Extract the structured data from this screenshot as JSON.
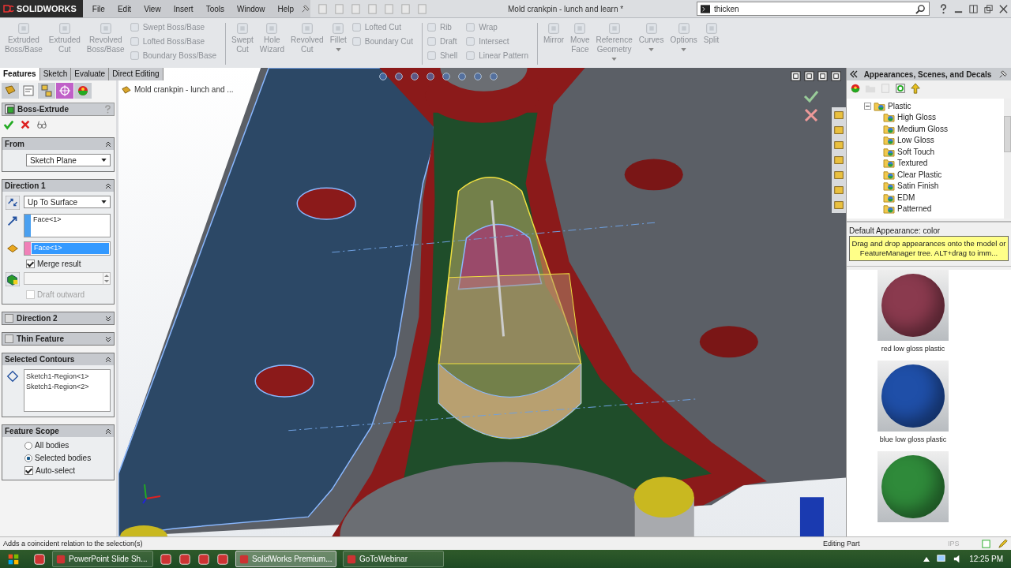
{
  "title_bar": {
    "logo": "SOLIDWORKS",
    "menu": [
      "File",
      "Edit",
      "View",
      "Insert",
      "Tools",
      "Window",
      "Help"
    ],
    "document_title": "Mold crankpin - lunch and learn *",
    "search": {
      "value": "thicken"
    }
  },
  "ribbon": [
    [
      {
        "kind": "large",
        "label": "Extruded Boss/Base"
      },
      {
        "kind": "large",
        "label": "Extruded Cut"
      },
      {
        "kind": "large",
        "label": "Revolved Boss/Base"
      },
      {
        "kind": "stack",
        "items": [
          "Swept Boss/Base",
          "Lofted Boss/Base",
          "Boundary Boss/Base"
        ]
      }
    ],
    [
      {
        "kind": "large",
        "label": "Swept Cut"
      },
      {
        "kind": "large",
        "label": "Hole Wizard"
      },
      {
        "kind": "large",
        "label": "Revolved Cut"
      },
      {
        "kind": "large",
        "label": "Fillet",
        "dropdown": true
      },
      {
        "kind": "stack",
        "items": [
          "Lofted Cut",
          "Boundary Cut"
        ]
      }
    ],
    [
      {
        "kind": "stack",
        "items": [
          "Rib",
          "Draft",
          "Shell"
        ]
      },
      {
        "kind": "stack",
        "items": [
          "Wrap",
          "Intersect",
          "Linear Pattern"
        ]
      }
    ],
    [
      {
        "kind": "large",
        "label": "Mirror"
      },
      {
        "kind": "large",
        "label": "Move Face"
      },
      {
        "kind": "large",
        "label": "Reference Geometry",
        "dropdown": true
      },
      {
        "kind": "large",
        "label": "Curves",
        "dropdown": true
      },
      {
        "kind": "large",
        "label": "Options",
        "dropdown": true
      },
      {
        "kind": "large",
        "label": "Split"
      }
    ]
  ],
  "tabs": [
    {
      "label": "Features",
      "selected": true
    },
    {
      "label": "Sketch",
      "selected": false
    },
    {
      "label": "Evaluate",
      "selected": false
    },
    {
      "label": "Direct Editing",
      "selected": false
    }
  ],
  "property_manager": {
    "title": "Boss-Extrude",
    "from": {
      "title": "From",
      "dropdown": "Sketch Plane"
    },
    "direction1": {
      "title": "Direction 1",
      "end_condition": "Up To Surface",
      "face_field": "Face<1>",
      "selected_face": "Face<1>",
      "merge_result": {
        "label": "Merge result",
        "checked": true
      },
      "draft_outward": {
        "label": "Draft outward",
        "checked": false,
        "disabled": true
      }
    },
    "direction2": {
      "title": "Direction 2",
      "checked": false
    },
    "thin_feature": {
      "title": "Thin Feature",
      "checked": false
    },
    "selected_contours": {
      "title": "Selected Contours",
      "items": [
        "Sketch1-Region<1>",
        "Sketch1-Region<2>"
      ]
    },
    "feature_scope": {
      "title": "Feature Scope",
      "options": [
        {
          "label": "All bodies",
          "selected": false
        },
        {
          "label": "Selected bodies",
          "selected": true
        }
      ],
      "auto_select": {
        "label": "Auto-select",
        "checked": true
      }
    }
  },
  "viewport": {
    "tree_item": "Mold crankpin - lunch and ..."
  },
  "appearances": {
    "title": "Appearances, Scenes, and Decals",
    "tree": {
      "label": "Plastic",
      "expanded": true,
      "children": [
        "High Gloss",
        "Medium Gloss",
        "Low Gloss",
        "Soft Touch",
        "Textured",
        "Clear Plastic",
        "Satin Finish",
        "EDM",
        "Patterned"
      ]
    },
    "default_label": "Default Appearance: color",
    "tooltip": "Drag and drop appearances onto the model or FeatureManager tree.  ALT+drag to imm...",
    "swatches": [
      {
        "label": "red low gloss plastic",
        "color": "#8a3a4e"
      },
      {
        "label": "blue low gloss plastic",
        "color": "#1f4fa8"
      },
      {
        "color": "#2f8a3a"
      }
    ]
  },
  "status_bar": {
    "message": "Adds a coincident relation to the selection(s)",
    "mode": "Editing Part",
    "units": "IPS"
  },
  "taskbar": {
    "items": [
      {
        "kind": "pinned"
      },
      {
        "kind": "window",
        "label": "PowerPoint Slide Sh...",
        "selected": false
      },
      {
        "kind": "pinned"
      },
      {
        "kind": "pinned"
      },
      {
        "kind": "pinned"
      },
      {
        "kind": "pinned"
      },
      {
        "kind": "window",
        "label": "SolidWorks Premium...",
        "selected": true
      },
      {
        "kind": "window",
        "label": "GoToWebinar",
        "selected": false
      }
    ],
    "clock": "12:25 PM"
  }
}
